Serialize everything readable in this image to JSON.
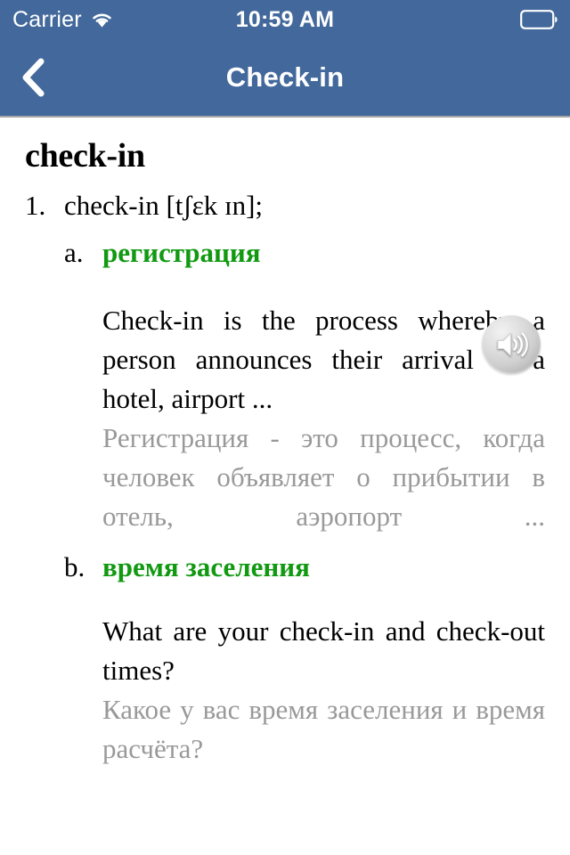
{
  "status_bar": {
    "carrier": "Carrier",
    "wifi_icon": "wifi-icon",
    "time": "10:59 AM",
    "battery_icon": "battery-icon"
  },
  "nav_bar": {
    "back_icon": "chevron-left-icon",
    "title": "Check-in"
  },
  "colors": {
    "nav_background": "#43699c",
    "translation_green": "#119911",
    "secondary_gray": "#999999",
    "page_background": "#ffffff",
    "primary_text": "#000000"
  },
  "article": {
    "headword": "check-in",
    "audio_button": {
      "icon": "speaker-icon",
      "label": "Play pronunciation"
    },
    "senses": [
      {
        "number": "1.",
        "headword": "check-in [tʃɛk ɪn];",
        "subsenses": [
          {
            "letter": "a.",
            "translation": "регистрация",
            "example_en": "Check-in is the process whereby a person announces their arrival at a hotel, airport ...",
            "example_ru": "Регистрация - это процесс, когда человек объявляет о прибытии в отель, аэропорт ..."
          },
          {
            "letter": "b.",
            "translation": "время заселения",
            "example_en": "What are your check-in and check-out times?",
            "example_ru": "Какое у вас время заселения и время расчёта?"
          }
        ]
      }
    ]
  }
}
